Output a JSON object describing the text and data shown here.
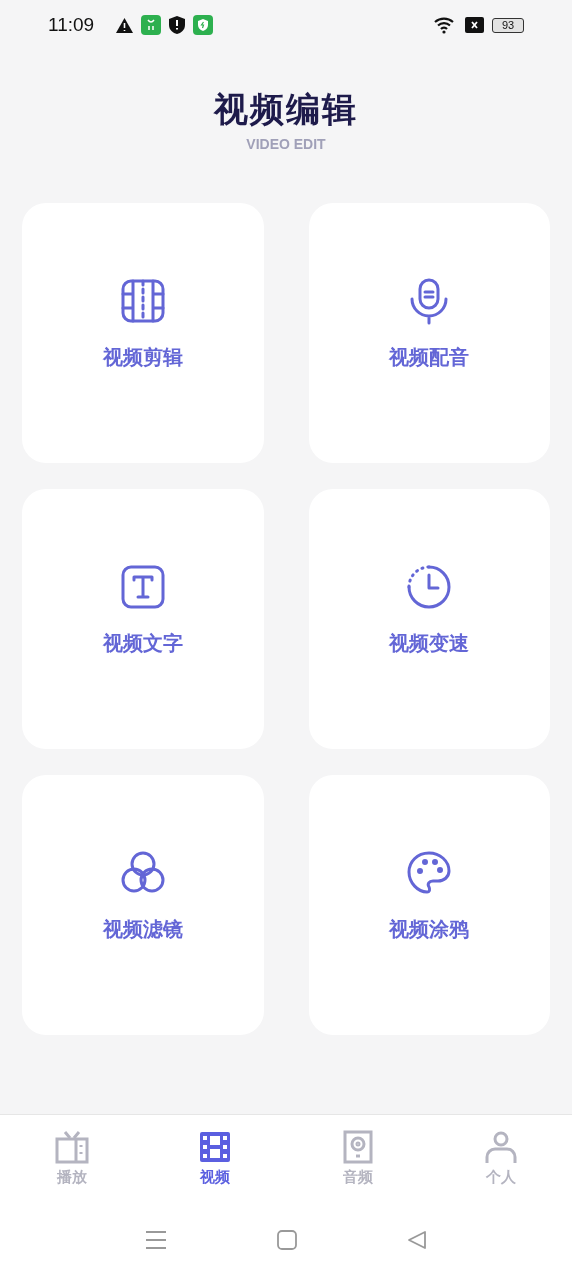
{
  "status_bar": {
    "time": "11:09",
    "battery": "93"
  },
  "header": {
    "title": "视频编辑",
    "subtitle": "VIDEO EDIT"
  },
  "cards": [
    {
      "kind": "cut",
      "label": "视频剪辑"
    },
    {
      "kind": "mic",
      "label": "视频配音"
    },
    {
      "kind": "text",
      "label": "视频文字"
    },
    {
      "kind": "speed",
      "label": "视频变速"
    },
    {
      "kind": "filter",
      "label": "视频滤镜"
    },
    {
      "kind": "palette",
      "label": "视频涂鸦"
    }
  ],
  "tabs": [
    {
      "kind": "tv",
      "label": "播放",
      "selected": false
    },
    {
      "kind": "film",
      "label": "视频",
      "selected": true
    },
    {
      "kind": "speaker",
      "label": "音频",
      "selected": false
    },
    {
      "kind": "person",
      "label": "个人",
      "selected": false
    }
  ]
}
